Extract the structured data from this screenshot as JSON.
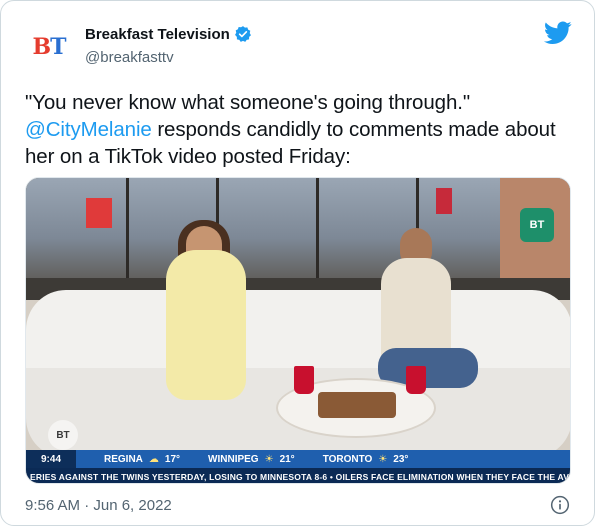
{
  "author": {
    "display_name": "Breakfast Television",
    "handle": "@breakfasttv",
    "avatar_text_b": "B",
    "avatar_text_t": "T"
  },
  "tweet": {
    "text_part1": "\"You never know what someone's going through.\"",
    "mention": "@CityMelanie",
    "text_part2": " responds candidly to comments made about her on a TikTok video posted Friday:",
    "timestamp": "9:56 AM · Jun 6, 2022"
  },
  "media": {
    "bug_text": "BT",
    "wall_logo_text": "BT",
    "weather_bar": {
      "time": "9:44",
      "items": [
        {
          "city": "REGINA",
          "temp": "17°"
        },
        {
          "city": "WINNIPEG",
          "temp": "21°"
        },
        {
          "city": "TORONTO",
          "temp": "23°"
        }
      ]
    },
    "ticker": "ERIES AGAINST THE TWINS YESTERDAY, LOSING TO MINNESOTA 8-6  •  OILERS FACE ELIMINATION WHEN THEY FACE THE AVALANCI"
  },
  "colors": {
    "mention": "#1d9bf0",
    "twitter_blue": "#1d9bf0",
    "weather_bar": "#1f5fae",
    "ticker": "#0b2a55"
  },
  "icons": {
    "verified": "verified-badge-icon",
    "twitter": "twitter-bird-icon",
    "info": "info-icon"
  }
}
